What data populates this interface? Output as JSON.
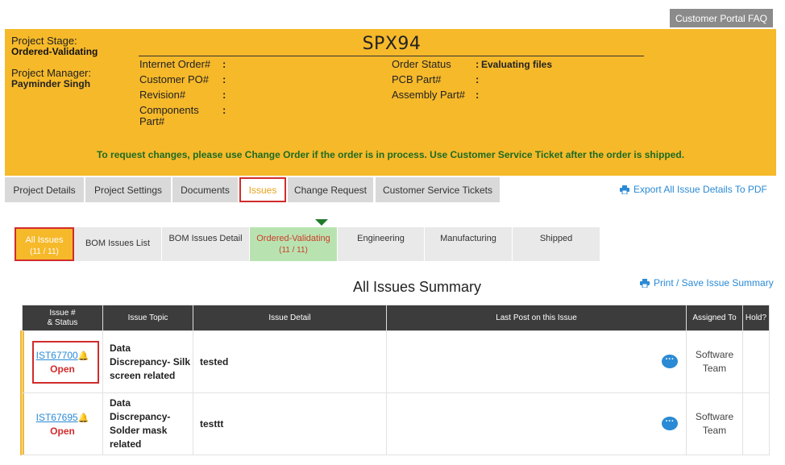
{
  "header": {
    "faq_label": "Customer Portal FAQ"
  },
  "project": {
    "stage_label": "Project Stage:",
    "stage_value": "Ordered-Validating",
    "pm_label": "Project Manager:",
    "pm_value": "Payminder Singh",
    "title": "SPX94",
    "fields_left": [
      {
        "label": "Internet Order#",
        "value": ""
      },
      {
        "label": "Customer PO#",
        "value": ""
      },
      {
        "label": "Revision#",
        "value": ""
      },
      {
        "label": "Components Part#",
        "value": ""
      }
    ],
    "fields_right": [
      {
        "label": "Order Status",
        "value": "Evaluating files"
      },
      {
        "label": "PCB Part#",
        "value": ""
      },
      {
        "label": "Assembly Part#",
        "value": ""
      }
    ],
    "notice": "To request changes, please use Change Order if the order is in process. Use Customer Service Ticket after the order is shipped."
  },
  "tabs": [
    {
      "label": "Project Details"
    },
    {
      "label": "Project Settings"
    },
    {
      "label": "Documents"
    },
    {
      "label": "Issues",
      "active": true
    },
    {
      "label": "Change Request"
    },
    {
      "label": "Customer Service Tickets"
    }
  ],
  "export_label": "Export All Issue Details To PDF",
  "subtabs": [
    {
      "label": "All Issues",
      "count": "(11 / 11)"
    },
    {
      "label": "BOM Issues List",
      "count": ""
    },
    {
      "label": "BOM Issues Detail",
      "count": ""
    },
    {
      "label": "Ordered-Validating",
      "count": "(11 / 11)"
    },
    {
      "label": "Engineering",
      "count": ""
    },
    {
      "label": "Manufacturing",
      "count": ""
    },
    {
      "label": "Shipped",
      "count": ""
    }
  ],
  "summary": {
    "title": "All Issues Summary",
    "print_label": "Print / Save Issue Summary",
    "columns": [
      "Issue #",
      "& Status",
      "Issue Topic",
      "Issue Detail",
      "Last Post on this Issue",
      "Assigned To",
      "Hold?"
    ],
    "rows": [
      {
        "id": "IST67700",
        "status": "Open",
        "topic": "Data Discrepancy- Silk screen related",
        "detail": "tested",
        "last_post": "",
        "assigned": "Software Team",
        "hold": ""
      },
      {
        "id": "IST67695",
        "status": "Open",
        "topic": "Data Discrepancy- Solder mask related",
        "detail": "testtt",
        "last_post": "",
        "assigned": "Software Team",
        "hold": ""
      }
    ]
  },
  "icons": {
    "bell": "bell-icon",
    "chat": "chat-bubble-icon",
    "printer": "printer-icon",
    "accent": "#f6b92a",
    "link": "#2a8ad5",
    "alert": "#d12c2c",
    "notice": "#1d6b22"
  }
}
